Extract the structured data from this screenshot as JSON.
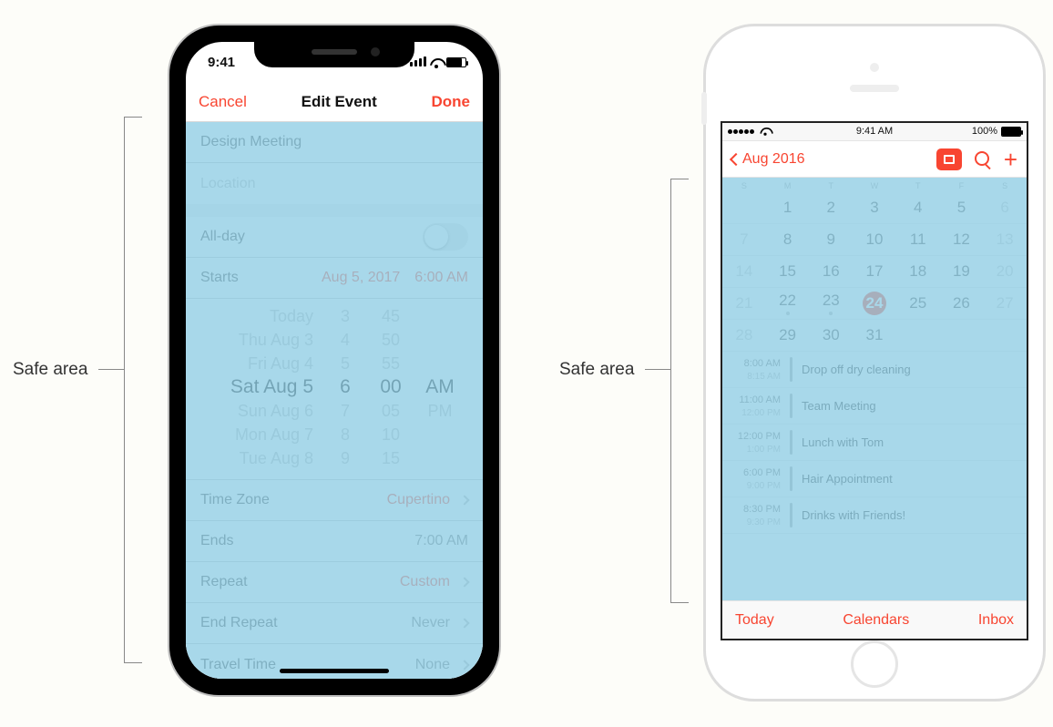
{
  "labels": {
    "safe_left": "Safe area",
    "safe_right": "Safe area"
  },
  "phoneX": {
    "status_time": "9:41",
    "nav": {
      "left": "Cancel",
      "title": "Edit Event",
      "right": "Done"
    },
    "eventTitle": "Design Meeting",
    "locationPlaceholder": "Location",
    "allday": "All-day",
    "starts": {
      "label": "Starts",
      "date": "Aug 5, 2017",
      "time": "6:00 AM"
    },
    "picker": {
      "rows": [
        [
          "Today",
          "3",
          "45",
          ""
        ],
        [
          "Thu Aug 3",
          "4",
          "50",
          ""
        ],
        [
          "Fri Aug 4",
          "5",
          "55",
          ""
        ],
        [
          "Sat Aug 5",
          "6",
          "00",
          "AM"
        ],
        [
          "Sun Aug 6",
          "7",
          "05",
          "PM"
        ],
        [
          "Mon Aug 7",
          "8",
          "10",
          ""
        ],
        [
          "Tue Aug 8",
          "9",
          "15",
          ""
        ]
      ],
      "selectedIndex": 3
    },
    "timezone": {
      "label": "Time Zone",
      "value": "Cupertino"
    },
    "ends": {
      "label": "Ends",
      "value": "7:00 AM"
    },
    "repeat": {
      "label": "Repeat",
      "value": "Custom"
    },
    "endrepeat": {
      "label": "End Repeat",
      "value": "Never"
    },
    "travel": {
      "label": "Travel Time",
      "value": "None"
    }
  },
  "phoneC": {
    "status": {
      "time": "9:41 AM",
      "battery": "100%"
    },
    "nav": {
      "back": "Aug 2016"
    },
    "weekdays": [
      "S",
      "M",
      "T",
      "W",
      "T",
      "F",
      "S"
    ],
    "weeks": [
      [
        {
          "n": ""
        },
        {
          "n": "1"
        },
        {
          "n": "2"
        },
        {
          "n": "3"
        },
        {
          "n": "4"
        },
        {
          "n": "5"
        },
        {
          "n": "6",
          "off": true
        }
      ],
      [
        {
          "n": "7",
          "off": true
        },
        {
          "n": "8"
        },
        {
          "n": "9"
        },
        {
          "n": "10"
        },
        {
          "n": "11"
        },
        {
          "n": "12"
        },
        {
          "n": "13",
          "off": true
        }
      ],
      [
        {
          "n": "14",
          "off": true
        },
        {
          "n": "15"
        },
        {
          "n": "16"
        },
        {
          "n": "17"
        },
        {
          "n": "18"
        },
        {
          "n": "19"
        },
        {
          "n": "20",
          "off": true
        }
      ],
      [
        {
          "n": "21",
          "off": true
        },
        {
          "n": "22",
          "dot": true
        },
        {
          "n": "23",
          "dot": true
        },
        {
          "n": "24",
          "sel": true
        },
        {
          "n": "25"
        },
        {
          "n": "26"
        },
        {
          "n": "27",
          "off": true
        }
      ],
      [
        {
          "n": "28",
          "off": true
        },
        {
          "n": "29"
        },
        {
          "n": "30"
        },
        {
          "n": "31"
        },
        {
          "n": ""
        },
        {
          "n": ""
        },
        {
          "n": ""
        }
      ]
    ],
    "events": [
      {
        "t1": "8:00 AM",
        "t2": "8:15 AM",
        "name": "Drop off dry cleaning"
      },
      {
        "t1": "11:00 AM",
        "t2": "12:00 PM",
        "name": "Team Meeting"
      },
      {
        "t1": "12:00 PM",
        "t2": "1:00 PM",
        "name": "Lunch with Tom"
      },
      {
        "t1": "6:00 PM",
        "t2": "9:00 PM",
        "name": "Hair Appointment"
      },
      {
        "t1": "8:30 PM",
        "t2": "9:30 PM",
        "name": "Drinks with Friends!"
      }
    ],
    "toolbar": {
      "left": "Today",
      "mid": "Calendars",
      "right": "Inbox"
    }
  }
}
